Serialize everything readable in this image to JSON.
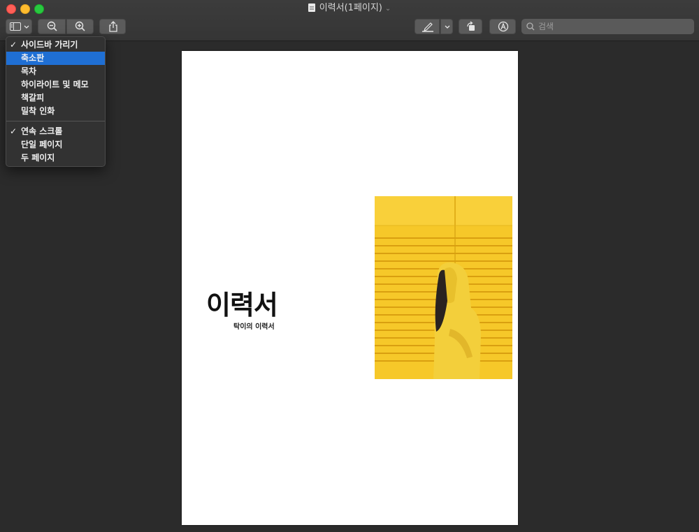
{
  "window": {
    "title": "이력서(1페이지)"
  },
  "toolbar": {
    "search_placeholder": "검색",
    "icons": [
      "sidebar-icon",
      "chevron-down-icon",
      "zoom-out-icon",
      "zoom-in-icon",
      "share-icon",
      "markup-pen-icon",
      "rotate-icon",
      "annotate-icon",
      "search-icon"
    ]
  },
  "menu": {
    "items": [
      {
        "label": "사이드바 가리기",
        "checked": "✓"
      },
      {
        "label": "축소판",
        "checked": ""
      },
      {
        "label": "목차",
        "checked": ""
      },
      {
        "label": "하이라이트 및 메모",
        "checked": ""
      },
      {
        "label": "책갈피",
        "checked": ""
      },
      {
        "label": "밀착 인화",
        "checked": ""
      },
      {
        "label": "연속 스크롤",
        "checked": "✓"
      },
      {
        "label": "단일 페이지",
        "checked": ""
      },
      {
        "label": "두 페이지",
        "checked": ""
      }
    ],
    "highlighted_index": 1,
    "highlight_color": "#1f6fd4"
  },
  "document": {
    "title": "이력서",
    "subtitle": "탁이의 이력서"
  },
  "colors": {
    "background": "#2b2b2b",
    "photo_yellow": "#f7c92a"
  }
}
